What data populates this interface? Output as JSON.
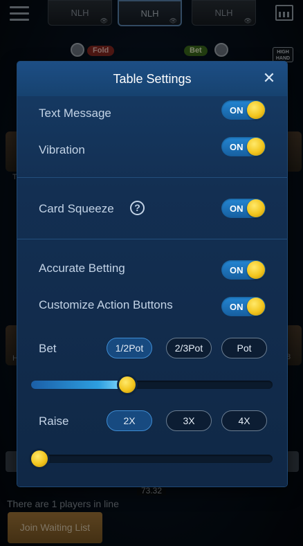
{
  "background": {
    "tabs": [
      {
        "label": "NLH",
        "active": false
      },
      {
        "label": "NLH",
        "active": true
      },
      {
        "label": "NLH",
        "active": false
      }
    ],
    "eye_glyph": "👁",
    "fold_badge": "Fold",
    "bet_badge": "Bet",
    "high_hand_line1": "HIGH",
    "high_hand_line2": "HAND",
    "side_text_top": "T",
    "side_text_mid": "H",
    "side_number": "8",
    "pot_value": "73.32",
    "waiting_text": "There are 1 players in line",
    "join_button": "Join Waiting List"
  },
  "modal": {
    "title": "Table Settings",
    "close_glyph": "✕",
    "toggles": {
      "text_message": {
        "label": "Text Message",
        "state": "ON"
      },
      "vibration": {
        "label": "Vibration",
        "state": "ON"
      },
      "card_squeeze": {
        "label": "Card Squeeze",
        "state": "ON"
      },
      "accurate_betting": {
        "label": "Accurate Betting",
        "state": "ON"
      },
      "customize_action_buttons": {
        "label": "Customize Action Buttons",
        "state": "ON"
      }
    },
    "help_glyph": "?",
    "bet": {
      "label": "Bet",
      "options": [
        "1/2Pot",
        "2/3Pot",
        "Pot"
      ],
      "selected": "1/2Pot",
      "slider_fraction": 0.39
    },
    "raise": {
      "label": "Raise",
      "options": [
        "2X",
        "3X",
        "4X"
      ],
      "selected": "2X",
      "slider_fraction": 0.0
    }
  },
  "colors": {
    "accent_blue": "#2486d3",
    "knob_gold": "#f2c51d",
    "modal_bg": "#132f52"
  }
}
